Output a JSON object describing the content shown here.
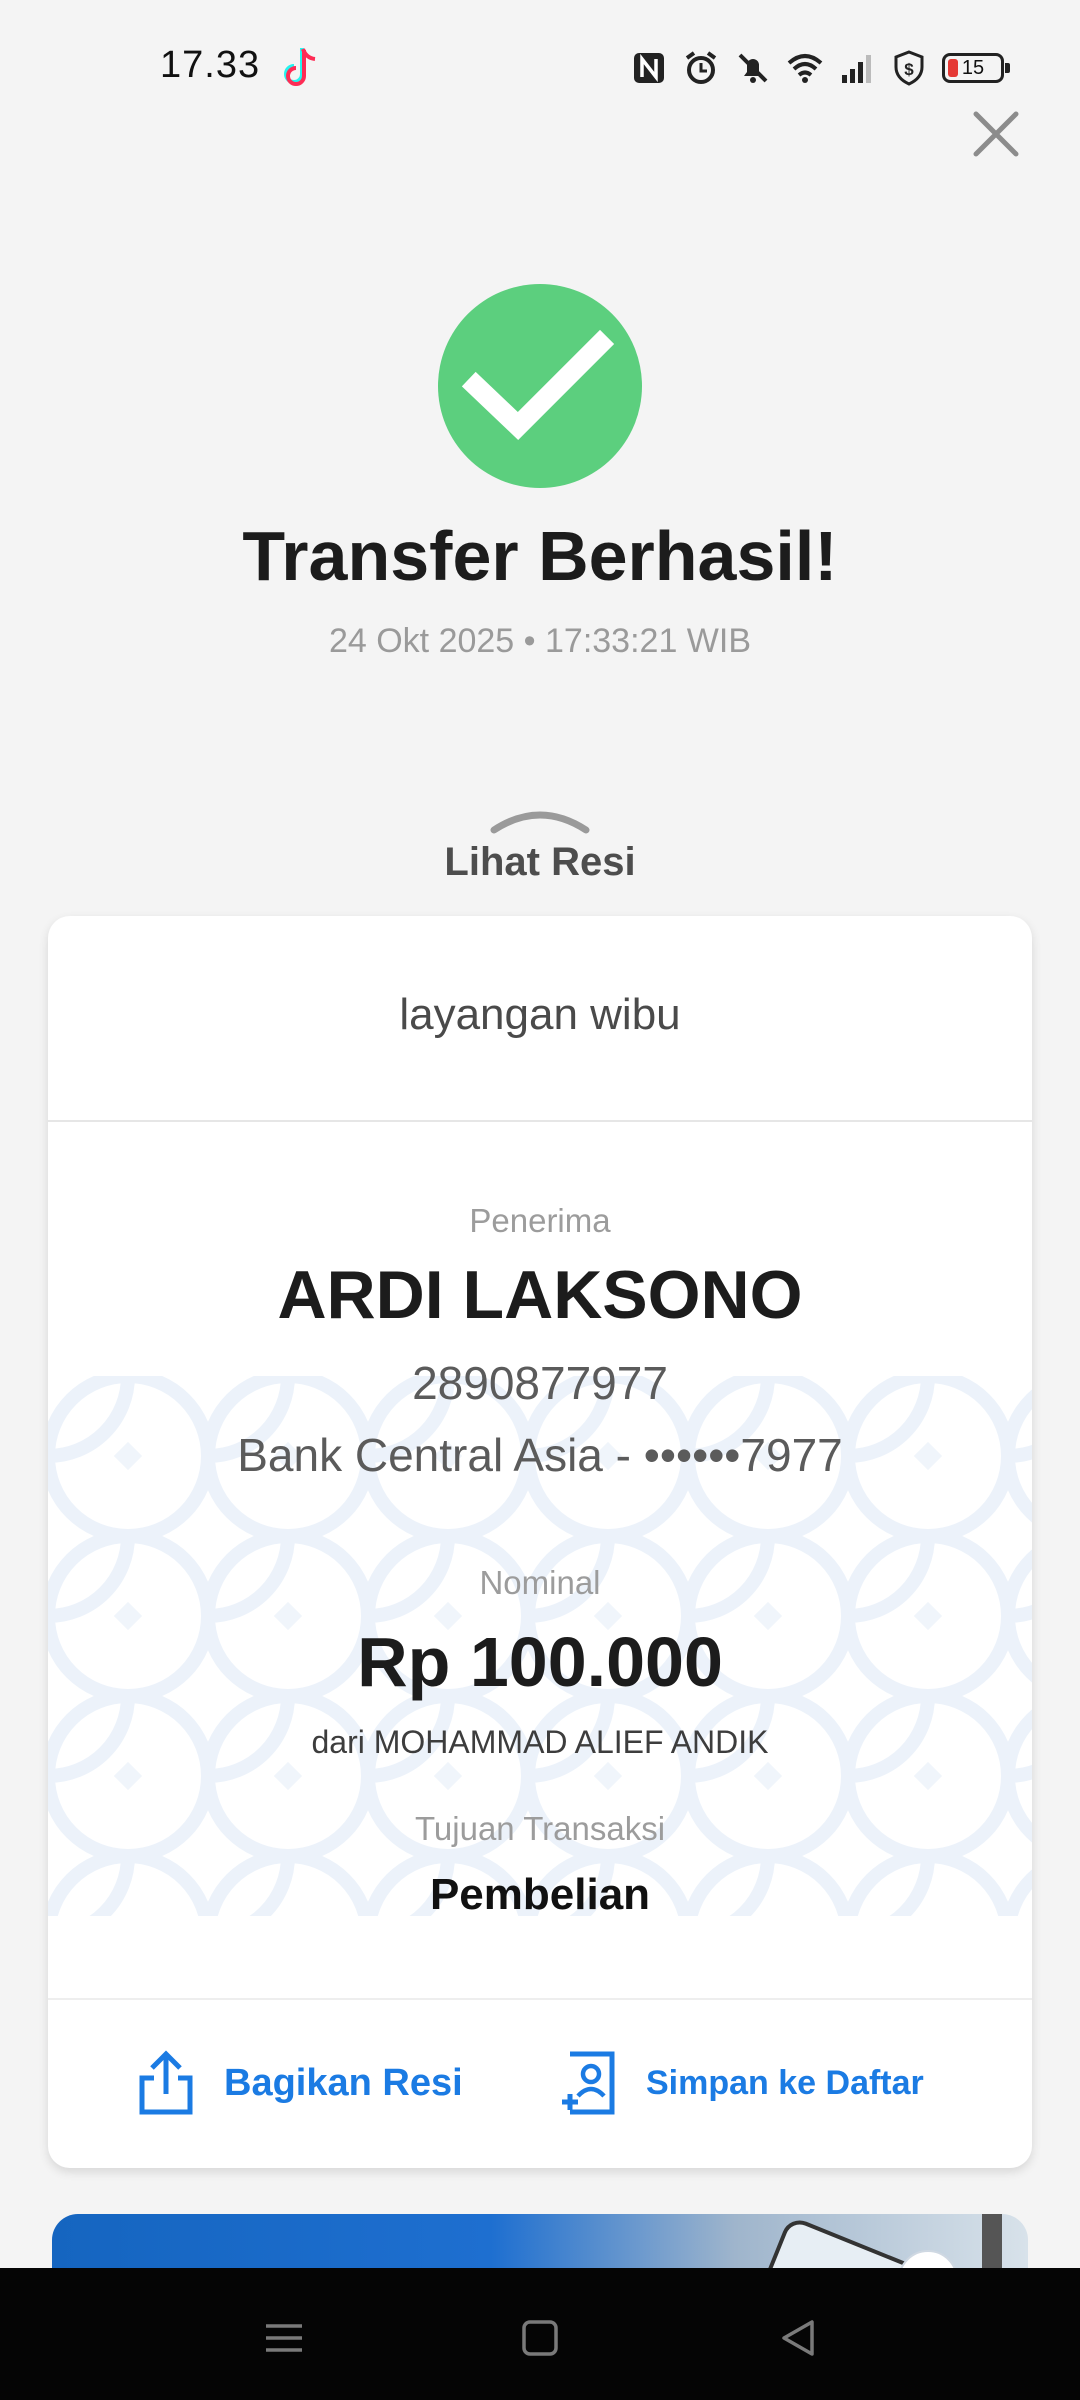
{
  "status_bar": {
    "time": "17.33",
    "battery_level": "15",
    "icons": [
      "tiktok-icon",
      "nfc-icon",
      "alarm-icon",
      "mute-icon",
      "wifi-icon",
      "signal-icon",
      "dollar-shield-icon",
      "battery-icon"
    ]
  },
  "header": {
    "close_icon": "close-icon",
    "title": "Transfer Berhasil!",
    "datetime": "24 Okt 2025 • 17:33:21 WIB"
  },
  "receipt_toggle": {
    "label": "Lihat Resi",
    "icon": "chevron-up-icon"
  },
  "receipt": {
    "note": "layangan wibu",
    "recipient_label": "Penerima",
    "recipient_name": "ARDI LAKSONO",
    "account_number": "2890877977",
    "bank_line": "Bank Central Asia - ••••••7977",
    "amount_label": "Nominal",
    "amount": "Rp 100.000",
    "from_line": "dari MOHAMMAD ALIEF ANDIK",
    "purpose_label": "Tujuan Transaksi",
    "purpose": "Pembelian"
  },
  "actions": {
    "share_label": "Bagikan Resi",
    "save_label": "Simpan ke Daftar"
  },
  "colors": {
    "success_green": "#5ccf7e",
    "accent_blue": "#1b7be3",
    "background": "#f4f4f4"
  },
  "nav_bar": {
    "icons": [
      "menu-icon",
      "home-icon",
      "back-icon"
    ]
  }
}
